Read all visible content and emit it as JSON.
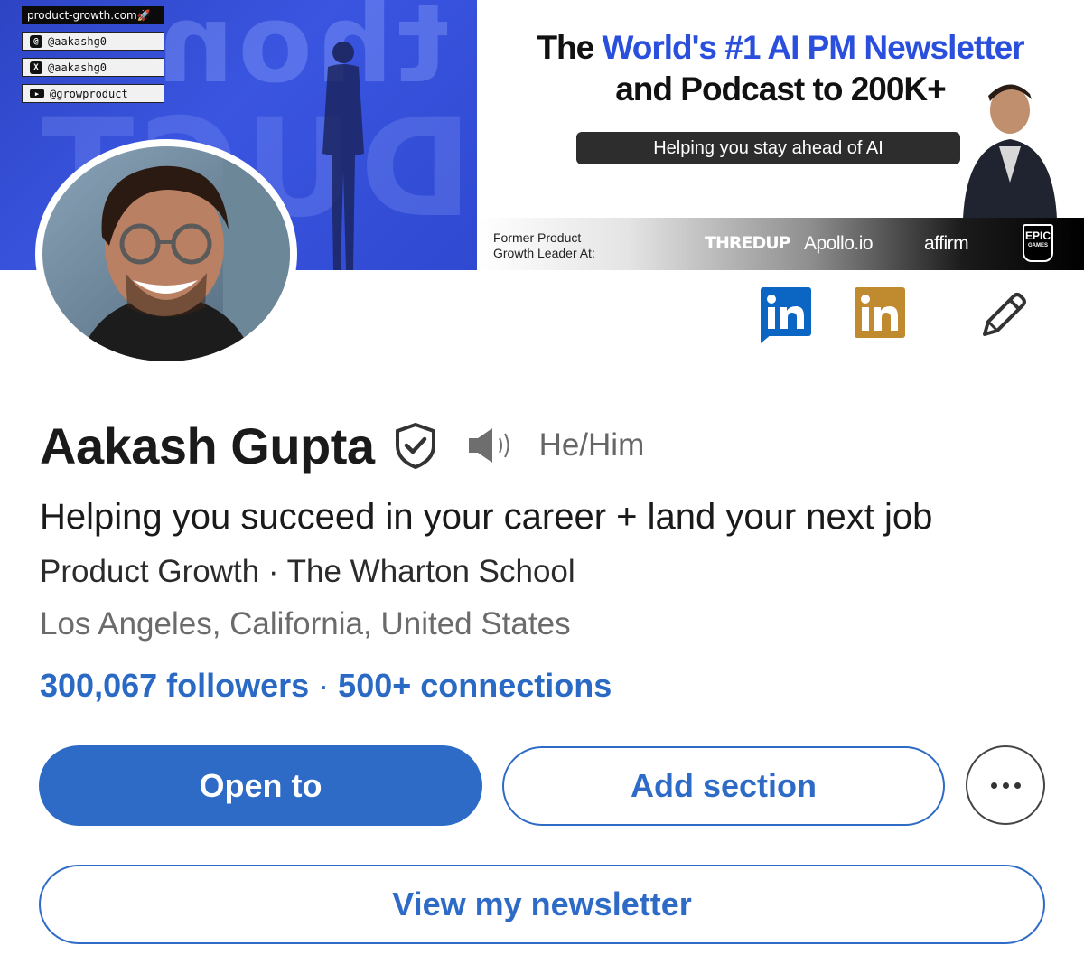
{
  "banner": {
    "social": {
      "url": "product-growth.com🚀",
      "threads_handle": "@aakashg0",
      "x_handle": "@aakashg0",
      "youtube_handle": "@growproduct"
    },
    "headline_the": "The",
    "headline_blue": "World's #1 AI PM Newsletter",
    "headline_line2": "and Podcast to 200K+",
    "pill": "Helping you stay ahead of AI",
    "former_label_line1": "Former Product",
    "former_label_line2": "Growth Leader At:",
    "logos": {
      "thredup": "THREDUP",
      "apollo": "Apollo.io",
      "affirm": "affirm",
      "epic": "EPIC",
      "epic_sub": "GAMES"
    }
  },
  "profile": {
    "name": "Aakash Gupta",
    "pronouns": "He/Him",
    "headline": "Helping you succeed in your career + land your next job",
    "company_line": "Product Growth · The Wharton School",
    "location": "Los Angeles, California, United States",
    "followers": "300,067 followers",
    "separator": "·",
    "connections": "500+ connections"
  },
  "actions": {
    "open_to": "Open to",
    "add_section": "Add section",
    "view_newsletter": "View my newsletter"
  },
  "colors": {
    "brand_blue": "#2e6bc6",
    "linkedin_blue": "#0a66c2",
    "linkedin_gold": "#c08a2e",
    "banner_blue": "#3a55e0"
  },
  "icons": [
    "threads-icon",
    "x-icon",
    "youtube-icon",
    "linkedin-icon",
    "linkedin-premium-icon",
    "pencil-icon",
    "verified-shield-icon",
    "speaker-icon",
    "more-icon"
  ]
}
